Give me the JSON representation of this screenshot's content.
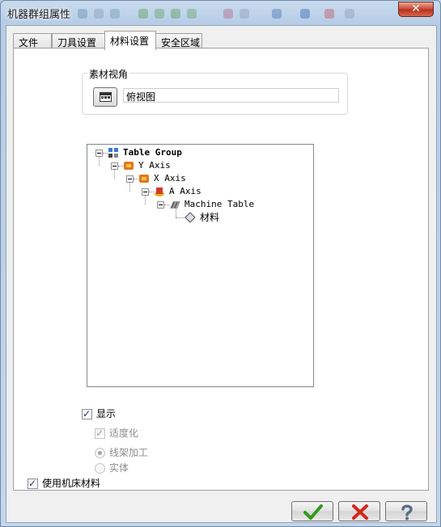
{
  "window": {
    "title": "机器群组属性",
    "close_label": "✕"
  },
  "tabs": [
    {
      "label": "文件"
    },
    {
      "label": "刀具设置"
    },
    {
      "label": "材料设置"
    },
    {
      "label": "安全区域"
    }
  ],
  "active_tab": "材料设置",
  "stock_view": {
    "group_label": "素材视角",
    "view_value": "俯视图"
  },
  "tree": {
    "items": [
      {
        "label": "Table Group",
        "icon": "table-group-icon"
      },
      {
        "label": "Y Axis",
        "icon": "axis-icon"
      },
      {
        "label": "X Axis",
        "icon": "axis-icon"
      },
      {
        "label": "A Axis",
        "icon": "rotary-axis-icon"
      },
      {
        "label": "Machine Table",
        "icon": "machine-table-icon"
      },
      {
        "label": "材料",
        "icon": "stock-diamond-icon"
      }
    ]
  },
  "options": {
    "display": {
      "label": "显示",
      "checked": true
    },
    "fit": {
      "label": "适度化",
      "checked": true,
      "enabled": false
    },
    "wireframe": {
      "label": "线架加工",
      "selected": true,
      "enabled": false
    },
    "solid": {
      "label": "实体",
      "selected": false,
      "enabled": false
    },
    "use_machine_stock": {
      "label": "使用机床材料",
      "checked": true
    }
  },
  "buttons": {
    "ok": "ok-checkmark-icon",
    "cancel": "cancel-x-icon",
    "help": "help-question-icon"
  },
  "colors": {
    "ok_green": "#2f9a1e",
    "cancel_red": "#d4261a",
    "help_blue": "#5a6d88"
  }
}
